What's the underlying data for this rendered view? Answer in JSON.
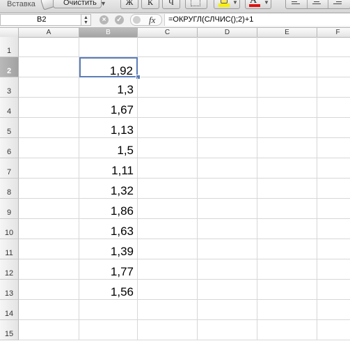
{
  "toolbar": {
    "paste_label": "Вставка",
    "clear_label": "Очистить",
    "bold_label": "Ж",
    "italic_label": "К",
    "underline_label": "Ч",
    "fill_color": "#f7f000",
    "font_color": "#e01010",
    "font_color_letter": "A"
  },
  "formula_bar": {
    "cell_ref": "B2",
    "fx_label": "fx",
    "formula": "=ОКРУГЛ(СЛЧИС();2)+1"
  },
  "sheet": {
    "columns": [
      "A",
      "B",
      "C",
      "D",
      "E",
      "F"
    ],
    "selected_column": "B",
    "selected_cell": "B2",
    "rows": [
      {
        "number": "1",
        "a": "",
        "b": ""
      },
      {
        "number": "2",
        "a": "",
        "b": "1,92"
      },
      {
        "number": "3",
        "a": "",
        "b": "1,3"
      },
      {
        "number": "4",
        "a": "",
        "b": "1,67"
      },
      {
        "number": "5",
        "a": "",
        "b": "1,13"
      },
      {
        "number": "6",
        "a": "",
        "b": "1,5"
      },
      {
        "number": "7",
        "a": "",
        "b": "1,11"
      },
      {
        "number": "8",
        "a": "",
        "b": "1,32"
      },
      {
        "number": "9",
        "a": "",
        "b": "1,86"
      },
      {
        "number": "10",
        "a": "",
        "b": "1,63"
      },
      {
        "number": "11",
        "a": "",
        "b": "1,39"
      },
      {
        "number": "12",
        "a": "",
        "b": "1,77"
      },
      {
        "number": "13",
        "a": "",
        "b": "1,56"
      },
      {
        "number": "14",
        "a": "",
        "b": ""
      },
      {
        "number": "15",
        "a": "",
        "b": ""
      }
    ]
  }
}
